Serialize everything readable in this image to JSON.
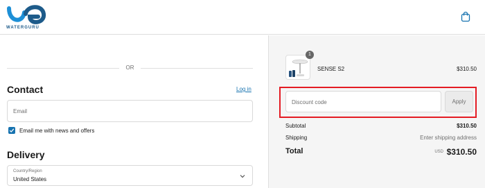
{
  "brand": {
    "name": "WATERGURU",
    "color": "#1d5b8a"
  },
  "header": {
    "cart_icon": "shopping-bag-icon"
  },
  "checkout": {
    "divider_text": "OR",
    "contact": {
      "title": "Contact",
      "login_link": "Log in",
      "email_placeholder": "Email",
      "newsletter_label": "Email me with news and offers",
      "newsletter_checked": true
    },
    "delivery": {
      "title": "Delivery",
      "country_label": "Country/Region",
      "country_value": "United States"
    }
  },
  "order_summary": {
    "item": {
      "name": "SENSE S2",
      "price": "$310.50",
      "quantity": "1"
    },
    "discount": {
      "placeholder": "Discount code",
      "apply_label": "Apply"
    },
    "subtotal": {
      "label": "Subtotal",
      "value": "$310.50"
    },
    "shipping": {
      "label": "Shipping",
      "value": "Enter shipping address"
    },
    "total": {
      "label": "Total",
      "currency": "USD",
      "value": "$310.50"
    }
  },
  "colors": {
    "accent": "#1773b0",
    "highlight": "#e41b23"
  }
}
